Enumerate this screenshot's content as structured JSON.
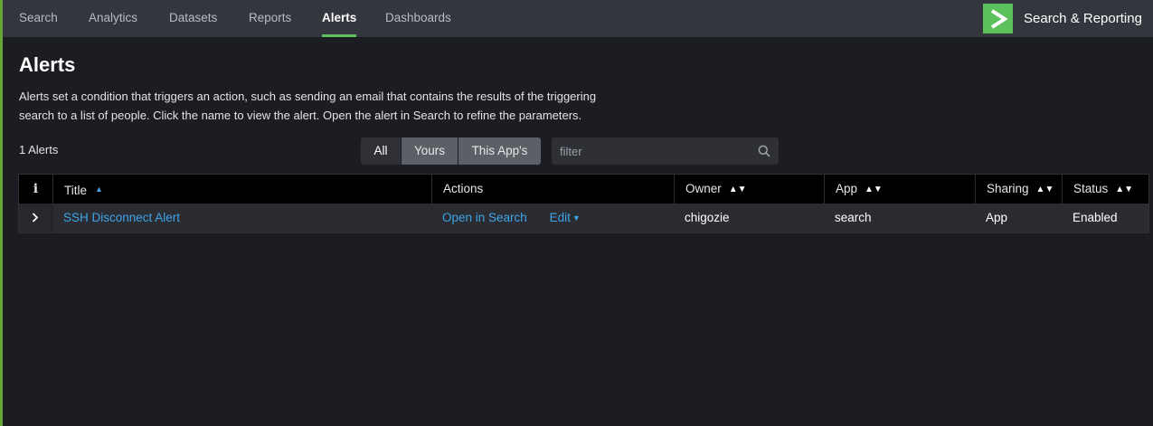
{
  "nav": {
    "tabs": [
      {
        "label": "Search",
        "active": false
      },
      {
        "label": "Analytics",
        "active": false
      },
      {
        "label": "Datasets",
        "active": false
      },
      {
        "label": "Reports",
        "active": false
      },
      {
        "label": "Alerts",
        "active": true
      },
      {
        "label": "Dashboards",
        "active": false
      }
    ],
    "app_name": "Search & Reporting",
    "app_logo_icon": "chevron-right-logo-icon"
  },
  "page": {
    "title": "Alerts",
    "description_line1": "Alerts set a condition that triggers an action, such as sending an email that contains the results of the triggering",
    "description_line2": "search to a list of people. Click the name to view the alert. Open the alert in Search to refine the parameters.",
    "count_label": "1 Alerts"
  },
  "filter_tabs": {
    "all": "All",
    "yours": "Yours",
    "this_app": "This App's",
    "selected": "All"
  },
  "search": {
    "placeholder": "filter",
    "value": ""
  },
  "table": {
    "headers": {
      "info": "i",
      "title": "Title",
      "actions": "Actions",
      "owner": "Owner",
      "app": "App",
      "sharing": "Sharing",
      "status": "Status"
    },
    "sort": {
      "column": "title",
      "direction": "ascending"
    },
    "rows": [
      {
        "title": "SSH Disconnect Alert",
        "open_in_search": "Open in Search",
        "edit": "Edit",
        "owner": "chigozie",
        "app": "search",
        "sharing": "App",
        "status": "Enabled"
      }
    ]
  },
  "colors": {
    "accent_green": "#5cc05c",
    "link_blue": "#3ea5ea",
    "nav_bg": "#33363d",
    "page_bg": "#1c1d22"
  }
}
